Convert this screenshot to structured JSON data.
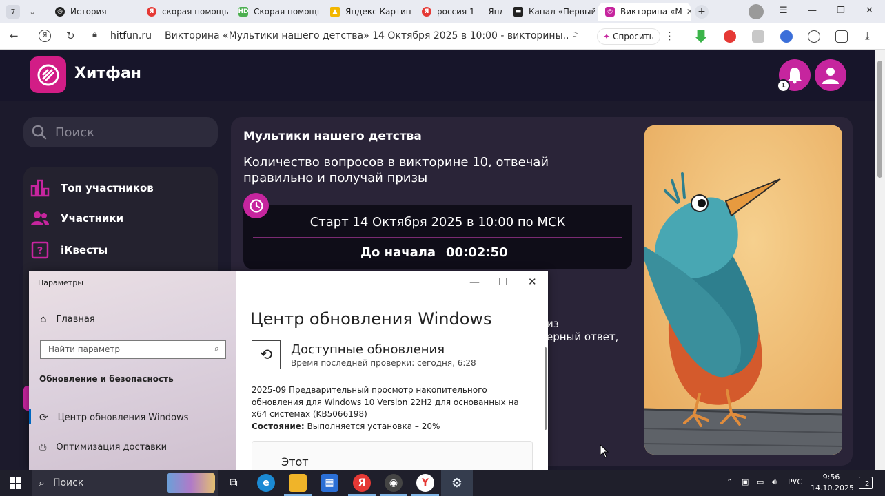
{
  "browser": {
    "tab_count": "7",
    "tabs": [
      {
        "label": "История",
        "color": "#222"
      },
      {
        "label": "скорая помощь",
        "color": "#e53935"
      },
      {
        "label": "Скорая помощь",
        "color": "#4caf50"
      },
      {
        "label": "Яндекс Картинк",
        "color": "#f2b600"
      },
      {
        "label": "россия 1 — Янд",
        "color": "#e53935"
      },
      {
        "label": "Канал «Первый",
        "color": "#222"
      },
      {
        "label": "Викторина «М",
        "color": "#c6259e"
      }
    ],
    "url_host": "hitfun.ru",
    "url_title": "Викторина «Мультики нашего детства» 14 Октября 2025 в 10:00 - викторины...",
    "ask_label": "Спросить"
  },
  "site": {
    "brand": "Хитфан",
    "notification_count": "1",
    "search_placeholder": "Поиск",
    "menu": [
      {
        "label": "Топ участников"
      },
      {
        "label": "Участники"
      },
      {
        "label": "iКвесты"
      }
    ],
    "quiz": {
      "title": "Мультики нашего детства",
      "description": "Количество вопросов в викторине 10, отвечай правильно и получай призы",
      "start_text": "Старт 14 Октября 2025 в 10:00 по МСК",
      "countdown_label": "До начала",
      "countdown_value": "00:02:50",
      "partial_1": "из",
      "partial_2": "ерный ответ,"
    }
  },
  "settings_window": {
    "app_title": "Параметры",
    "home_label": "Главная",
    "find_placeholder": "Найти параметр",
    "category": "Обновление и безопасность",
    "nav_items": [
      {
        "label": "Центр обновления Windows",
        "selected": true
      },
      {
        "label": "Оптимизация доставки",
        "selected": false
      }
    ],
    "page_title": "Центр обновления Windows",
    "section_title": "Доступные обновления",
    "last_check": "Время последней проверки: сегодня, 6:28",
    "update_text": "2025-09 Предварительный просмотр накопительного обновления для Windows 10 Version 22H2 для основанных на x64 системах (KB5066198)",
    "state_label": "Состояние:",
    "state_value": "Выполняется установка – 20%",
    "box_text": "Этот"
  },
  "taskbar": {
    "search_label": "Поиск",
    "language": "РУС",
    "time": "9:56",
    "date": "14.10.2025",
    "notification_count": "2"
  },
  "colors": {
    "accent": "#c6259e",
    "brand": "#d21d86",
    "page_bg": "#1c1a2c"
  }
}
